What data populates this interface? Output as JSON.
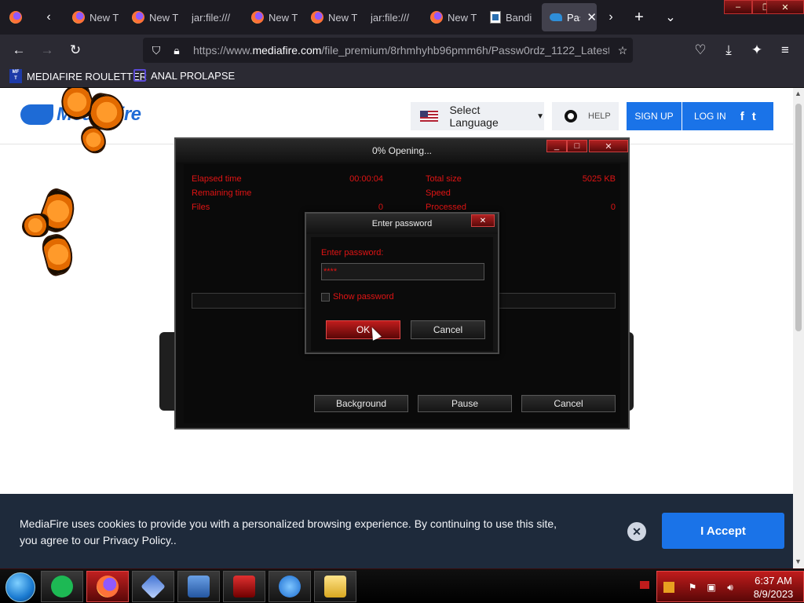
{
  "browser": {
    "tabs": [
      {
        "label": "New T",
        "icon": "firefox-icon"
      },
      {
        "label": "New T",
        "icon": "firefox-icon"
      },
      {
        "label": "jar:file:///",
        "icon": "none"
      },
      {
        "label": "New T",
        "icon": "firefox-icon"
      },
      {
        "label": "New T",
        "icon": "firefox-icon"
      },
      {
        "label": "jar:file:///",
        "icon": "none"
      },
      {
        "label": "New T",
        "icon": "firefox-icon"
      },
      {
        "label": "Bandi",
        "icon": "document-icon"
      },
      {
        "label": "Pas",
        "icon": "mediafire-icon",
        "active": true
      }
    ],
    "url_prefix": "https://www.",
    "url_domain": "mediafire.com",
    "url_path": "/file_premium/8rhmhyhb96pmm6h/Passw0rdz_1122_Latest",
    "bookmarks": [
      {
        "label": "MEDIAFIRE ROULETTER",
        "icon": "mft-icon"
      },
      {
        "label": "ANAL PROLAPSE",
        "icon": "sigma-icon"
      }
    ]
  },
  "mediafire": {
    "logo": "MediaFire",
    "language_label": "Select Language",
    "help_label": "HELP",
    "signup_label": "SIGN UP",
    "login_label": "LOG IN",
    "social": [
      "f",
      "t"
    ]
  },
  "extract_dialog": {
    "title": "0% Opening...",
    "stats": {
      "elapsed_label": "Elapsed time",
      "elapsed_value": "00:00:04",
      "remaining_label": "Remaining time",
      "files_label": "Files",
      "files_value": "0",
      "total_label": "Total size",
      "total_value": "5025 KB",
      "speed_label": "Speed",
      "processed_label": "Processed",
      "processed_value": "0"
    },
    "progress": 0,
    "buttons": {
      "background": "Background",
      "pause": "Pause",
      "cancel": "Cancel"
    }
  },
  "password_dialog": {
    "title": "Enter password",
    "label": "Enter password:",
    "value": "****",
    "show_password_label": "Show password",
    "show_password_checked": false,
    "ok_label": "OK",
    "cancel_label": "Cancel"
  },
  "cookie_banner": {
    "text": "MediaFire uses cookies to provide you with a personalized browsing experience. By continuing to use this site, you agree to our Privacy Policy..",
    "accept_label": "I Accept"
  },
  "taskbar": {
    "apps": [
      "spotify-icon",
      "firefox-icon",
      "virtualbox-icon",
      "7zip-icon",
      "bandizip-icon",
      "internet-explorer-icon",
      "file-explorer-icon"
    ],
    "time": "6:37 AM",
    "date": "8/9/2023"
  },
  "colors": {
    "accent_red": "#e01414",
    "mediafire_blue": "#1a73e8",
    "cookie_bg": "#1e2a3b"
  }
}
